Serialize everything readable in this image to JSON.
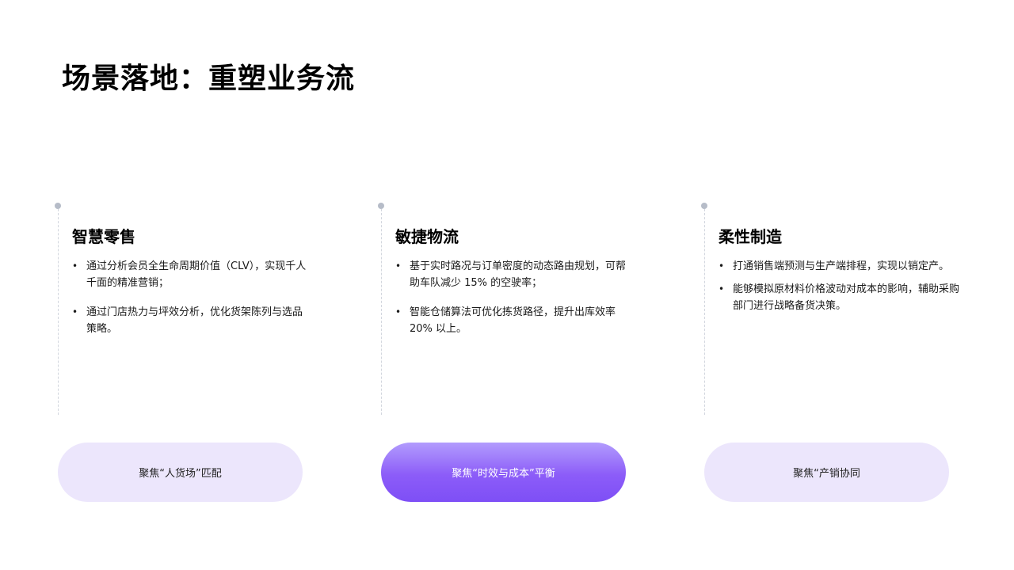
{
  "page": {
    "title": "场景落地：重塑业务流"
  },
  "columns": [
    {
      "title": "智慧零售",
      "bullets": [
        "通过分析会员全生命周期价值（CLV），实现千人千面的精准营销；",
        "通过门店热力与坪效分析，优化货架陈列与选品策略。"
      ],
      "focus_label": "聚焦“人货场”匹配"
    },
    {
      "title": "敏捷物流",
      "bullets": [
        "基于实时路况与订单密度的动态路由规划，可帮助车队减少 15% 的空驶率；",
        "智能仓储算法可优化拣货路径，提升出库效率 20% 以上。"
      ],
      "focus_label": "聚焦“时效与成本”平衡"
    },
    {
      "title": "柔性制造",
      "bullets": [
        "打通销售端预测与生产端排程，实现以销定产。",
        "能够模拟原材料价格波动对成本的影响，辅助采购部门进行战略备货决策。"
      ],
      "focus_label": "聚焦“产销协同"
    }
  ],
  "colors": {
    "pill_light": "#ece6fc",
    "pill_active_top": "#b29cfd",
    "pill_active_bottom": "#7e4ff6",
    "timeline_dot": "#b6bcc8"
  }
}
